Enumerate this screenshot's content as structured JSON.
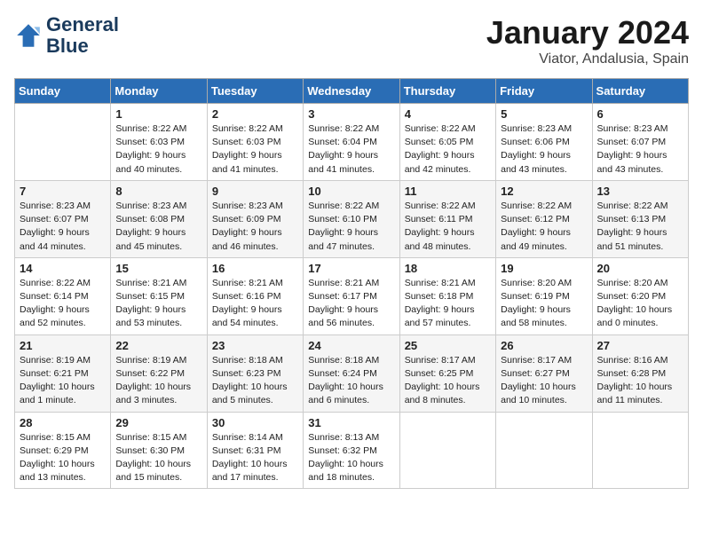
{
  "header": {
    "logo_line1": "General",
    "logo_line2": "Blue",
    "month": "January 2024",
    "location": "Viator, Andalusia, Spain"
  },
  "days_of_week": [
    "Sunday",
    "Monday",
    "Tuesday",
    "Wednesday",
    "Thursday",
    "Friday",
    "Saturday"
  ],
  "weeks": [
    [
      {
        "day": null,
        "sunrise": null,
        "sunset": null,
        "daylight": null
      },
      {
        "day": "1",
        "sunrise": "Sunrise: 8:22 AM",
        "sunset": "Sunset: 6:03 PM",
        "daylight": "Daylight: 9 hours and 40 minutes."
      },
      {
        "day": "2",
        "sunrise": "Sunrise: 8:22 AM",
        "sunset": "Sunset: 6:03 PM",
        "daylight": "Daylight: 9 hours and 41 minutes."
      },
      {
        "day": "3",
        "sunrise": "Sunrise: 8:22 AM",
        "sunset": "Sunset: 6:04 PM",
        "daylight": "Daylight: 9 hours and 41 minutes."
      },
      {
        "day": "4",
        "sunrise": "Sunrise: 8:22 AM",
        "sunset": "Sunset: 6:05 PM",
        "daylight": "Daylight: 9 hours and 42 minutes."
      },
      {
        "day": "5",
        "sunrise": "Sunrise: 8:23 AM",
        "sunset": "Sunset: 6:06 PM",
        "daylight": "Daylight: 9 hours and 43 minutes."
      },
      {
        "day": "6",
        "sunrise": "Sunrise: 8:23 AM",
        "sunset": "Sunset: 6:07 PM",
        "daylight": "Daylight: 9 hours and 43 minutes."
      }
    ],
    [
      {
        "day": "7",
        "sunrise": "Sunrise: 8:23 AM",
        "sunset": "Sunset: 6:07 PM",
        "daylight": "Daylight: 9 hours and 44 minutes."
      },
      {
        "day": "8",
        "sunrise": "Sunrise: 8:23 AM",
        "sunset": "Sunset: 6:08 PM",
        "daylight": "Daylight: 9 hours and 45 minutes."
      },
      {
        "day": "9",
        "sunrise": "Sunrise: 8:23 AM",
        "sunset": "Sunset: 6:09 PM",
        "daylight": "Daylight: 9 hours and 46 minutes."
      },
      {
        "day": "10",
        "sunrise": "Sunrise: 8:22 AM",
        "sunset": "Sunset: 6:10 PM",
        "daylight": "Daylight: 9 hours and 47 minutes."
      },
      {
        "day": "11",
        "sunrise": "Sunrise: 8:22 AM",
        "sunset": "Sunset: 6:11 PM",
        "daylight": "Daylight: 9 hours and 48 minutes."
      },
      {
        "day": "12",
        "sunrise": "Sunrise: 8:22 AM",
        "sunset": "Sunset: 6:12 PM",
        "daylight": "Daylight: 9 hours and 49 minutes."
      },
      {
        "day": "13",
        "sunrise": "Sunrise: 8:22 AM",
        "sunset": "Sunset: 6:13 PM",
        "daylight": "Daylight: 9 hours and 51 minutes."
      }
    ],
    [
      {
        "day": "14",
        "sunrise": "Sunrise: 8:22 AM",
        "sunset": "Sunset: 6:14 PM",
        "daylight": "Daylight: 9 hours and 52 minutes."
      },
      {
        "day": "15",
        "sunrise": "Sunrise: 8:21 AM",
        "sunset": "Sunset: 6:15 PM",
        "daylight": "Daylight: 9 hours and 53 minutes."
      },
      {
        "day": "16",
        "sunrise": "Sunrise: 8:21 AM",
        "sunset": "Sunset: 6:16 PM",
        "daylight": "Daylight: 9 hours and 54 minutes."
      },
      {
        "day": "17",
        "sunrise": "Sunrise: 8:21 AM",
        "sunset": "Sunset: 6:17 PM",
        "daylight": "Daylight: 9 hours and 56 minutes."
      },
      {
        "day": "18",
        "sunrise": "Sunrise: 8:21 AM",
        "sunset": "Sunset: 6:18 PM",
        "daylight": "Daylight: 9 hours and 57 minutes."
      },
      {
        "day": "19",
        "sunrise": "Sunrise: 8:20 AM",
        "sunset": "Sunset: 6:19 PM",
        "daylight": "Daylight: 9 hours and 58 minutes."
      },
      {
        "day": "20",
        "sunrise": "Sunrise: 8:20 AM",
        "sunset": "Sunset: 6:20 PM",
        "daylight": "Daylight: 10 hours and 0 minutes."
      }
    ],
    [
      {
        "day": "21",
        "sunrise": "Sunrise: 8:19 AM",
        "sunset": "Sunset: 6:21 PM",
        "daylight": "Daylight: 10 hours and 1 minute."
      },
      {
        "day": "22",
        "sunrise": "Sunrise: 8:19 AM",
        "sunset": "Sunset: 6:22 PM",
        "daylight": "Daylight: 10 hours and 3 minutes."
      },
      {
        "day": "23",
        "sunrise": "Sunrise: 8:18 AM",
        "sunset": "Sunset: 6:23 PM",
        "daylight": "Daylight: 10 hours and 5 minutes."
      },
      {
        "day": "24",
        "sunrise": "Sunrise: 8:18 AM",
        "sunset": "Sunset: 6:24 PM",
        "daylight": "Daylight: 10 hours and 6 minutes."
      },
      {
        "day": "25",
        "sunrise": "Sunrise: 8:17 AM",
        "sunset": "Sunset: 6:25 PM",
        "daylight": "Daylight: 10 hours and 8 minutes."
      },
      {
        "day": "26",
        "sunrise": "Sunrise: 8:17 AM",
        "sunset": "Sunset: 6:27 PM",
        "daylight": "Daylight: 10 hours and 10 minutes."
      },
      {
        "day": "27",
        "sunrise": "Sunrise: 8:16 AM",
        "sunset": "Sunset: 6:28 PM",
        "daylight": "Daylight: 10 hours and 11 minutes."
      }
    ],
    [
      {
        "day": "28",
        "sunrise": "Sunrise: 8:15 AM",
        "sunset": "Sunset: 6:29 PM",
        "daylight": "Daylight: 10 hours and 13 minutes."
      },
      {
        "day": "29",
        "sunrise": "Sunrise: 8:15 AM",
        "sunset": "Sunset: 6:30 PM",
        "daylight": "Daylight: 10 hours and 15 minutes."
      },
      {
        "day": "30",
        "sunrise": "Sunrise: 8:14 AM",
        "sunset": "Sunset: 6:31 PM",
        "daylight": "Daylight: 10 hours and 17 minutes."
      },
      {
        "day": "31",
        "sunrise": "Sunrise: 8:13 AM",
        "sunset": "Sunset: 6:32 PM",
        "daylight": "Daylight: 10 hours and 18 minutes."
      },
      {
        "day": null,
        "sunrise": null,
        "sunset": null,
        "daylight": null
      },
      {
        "day": null,
        "sunrise": null,
        "sunset": null,
        "daylight": null
      },
      {
        "day": null,
        "sunrise": null,
        "sunset": null,
        "daylight": null
      }
    ]
  ]
}
